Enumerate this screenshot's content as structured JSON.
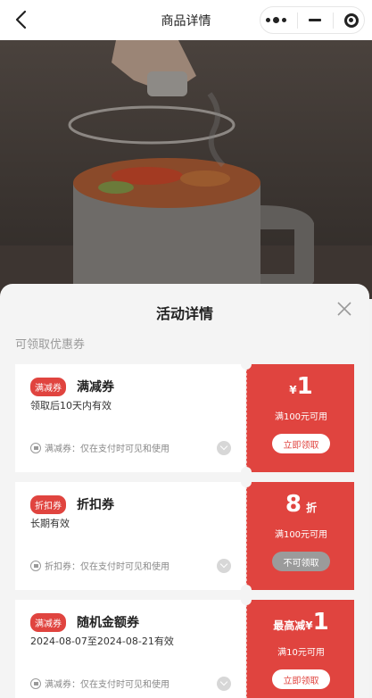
{
  "header": {
    "title": "商品详情"
  },
  "sheet": {
    "title": "活动详情",
    "section_label": "可领取优惠券"
  },
  "coupons": [
    {
      "tag": "满减券",
      "name": "满减券",
      "validity": "领取后10天内有效",
      "note": "满减券：仅在支付时可见和使用",
      "amount_prefix": "¥",
      "amount": "1",
      "amount_suffix": "",
      "condition": "满100元可用",
      "action": "立即领取",
      "action_enabled": true
    },
    {
      "tag": "折扣券",
      "name": "折扣券",
      "validity": "长期有效",
      "note": "折扣券：仅在支付时可见和使用",
      "amount_prefix": "",
      "amount": "8",
      "amount_suffix": "折",
      "condition": "满100元可用",
      "action": "不可领取",
      "action_enabled": false
    },
    {
      "tag": "满减券",
      "name": "随机金额券",
      "validity": "2024-08-07至2024-08-21有效",
      "note": "满减券：仅在支付时可见和使用",
      "amount_prefix": "最高减¥",
      "amount": "1",
      "amount_suffix": "",
      "condition": "满10元可用",
      "action": "立即领取",
      "action_enabled": true
    }
  ],
  "colors": {
    "accent": "#e0443f",
    "sheet_bg": "#f4f4f4",
    "disabled": "#9b9b9b"
  }
}
